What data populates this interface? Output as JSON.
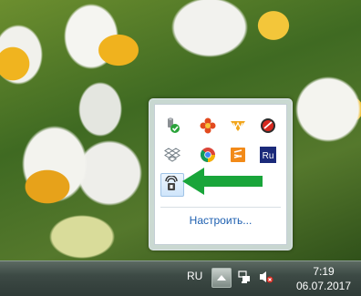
{
  "tray_popup": {
    "customize_label": "Настроить...",
    "icons": [
      {
        "name": "usb-safe-remove-icon"
      },
      {
        "name": "flower-app-icon"
      },
      {
        "name": "winamp-icon"
      },
      {
        "name": "red-circle-app-icon"
      },
      {
        "name": "dropbox-icon"
      },
      {
        "name": "chrome-icon"
      },
      {
        "name": "sublime-text-icon"
      },
      {
        "name": "ru-app-icon"
      },
      {
        "name": "vpn-lock-icon"
      }
    ]
  },
  "taskbar": {
    "language": "RU",
    "time": "7:19",
    "date": "06.07.2017"
  },
  "colors": {
    "arrow": "#19a53a",
    "link": "#1d5fb0"
  }
}
